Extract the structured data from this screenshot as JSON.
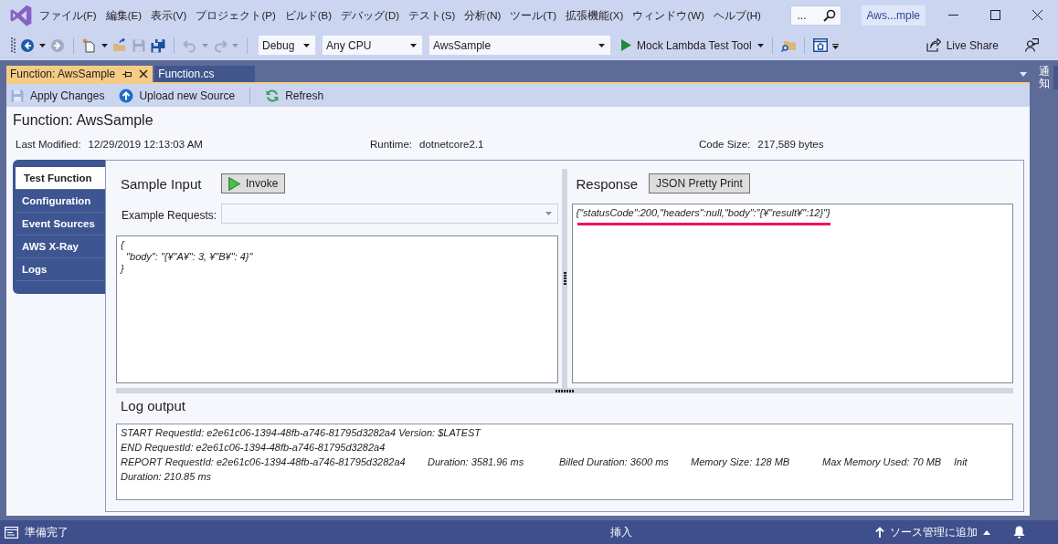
{
  "window": {
    "title": "Aws...mple"
  },
  "menu": [
    "ファイル(F)",
    "編集(E)",
    "表示(V)",
    "プロジェクト(P)",
    "ビルド(B)",
    "デバッグ(D)",
    "テスト(S)",
    "分析(N)",
    "ツール(T)",
    "拡張機能(X)",
    "ウィンドウ(W)",
    "ヘルプ(H)"
  ],
  "search": {
    "value": "..."
  },
  "toolbar": {
    "buttons": [
      {
        "kind": "back",
        "disabled": false
      },
      {
        "kind": "forward",
        "disabled": true
      },
      {
        "kind": "new_project",
        "disabled": false
      },
      {
        "kind": "open",
        "disabled": false
      },
      {
        "kind": "save",
        "disabled": true
      },
      {
        "kind": "save_all",
        "disabled": false
      },
      {
        "kind": "undo",
        "disabled": true
      },
      {
        "kind": "redo",
        "disabled": true
      }
    ],
    "configuration": "Debug",
    "platform": "Any CPU",
    "startup_project": "AwsSample",
    "run_button": "Mock Lambda Test Tool",
    "live_share": "Live Share"
  },
  "document_tabs": [
    {
      "label": "Function: AwsSample",
      "selected": true
    },
    {
      "label": "Function.cs",
      "selected": false
    }
  ],
  "side_tabs": [
    "通知"
  ],
  "document_toolbar": [
    {
      "kind": "save",
      "label": "Apply Changes"
    },
    {
      "kind": "upload",
      "label": "Upload new Source"
    },
    {
      "kind": "refresh",
      "label": "Refresh"
    }
  ],
  "function": {
    "title": "Function: AwsSample",
    "details": [
      {
        "label": "Last Modified:",
        "value": "12/29/2019 12:13:03 AM"
      },
      {
        "label": "Runtime:",
        "value": "dotnetcore2.1"
      },
      {
        "label": "Code Size:",
        "value": "217,589 bytes"
      }
    ]
  },
  "test_tabs": [
    {
      "label": "Test Function",
      "selected": true
    },
    {
      "label": "Configuration",
      "selected": false
    },
    {
      "label": "Event Sources",
      "selected": false
    },
    {
      "label": "AWS X-Ray",
      "selected": false
    },
    {
      "label": "Logs",
      "selected": false
    }
  ],
  "sample_input": {
    "title": "Sample Input",
    "invoke_button": "Invoke",
    "example_requests_label": "Example Requests:",
    "body_lines": [
      "{",
      "  \"body\": \"{¥\"A¥\": 3, ¥\"B¥\": 4}\"",
      "}"
    ]
  },
  "response": {
    "title": "Response",
    "pretty_print_button": "JSON Pretty Print",
    "text": "{\"statusCode\":200,\"headers\":null,\"body\":\"{¥\"result¥\":12}\"}",
    "underlined": true
  },
  "log_output": {
    "title": "Log output",
    "lines": [
      "START RequestId: e2e61c06-1394-48fb-a746-81795d3282a4 Version: $LATEST",
      "END RequestId: e2e61c06-1394-48fb-a746-81795d3282a4",
      "REPORT RequestId: e2e61c06-1394-48fb-a746-81795d3282a4\tDuration: 3581.96 ms\tBilled Duration: 3600 ms\tMemory Size: 128 MB\tMax Memory Used: 70 MB\tInit Duration: 210.85 ms"
    ]
  },
  "status_bar": {
    "message": "準備完了",
    "mode": "挿入",
    "source_control": "ソース管理に追加"
  }
}
